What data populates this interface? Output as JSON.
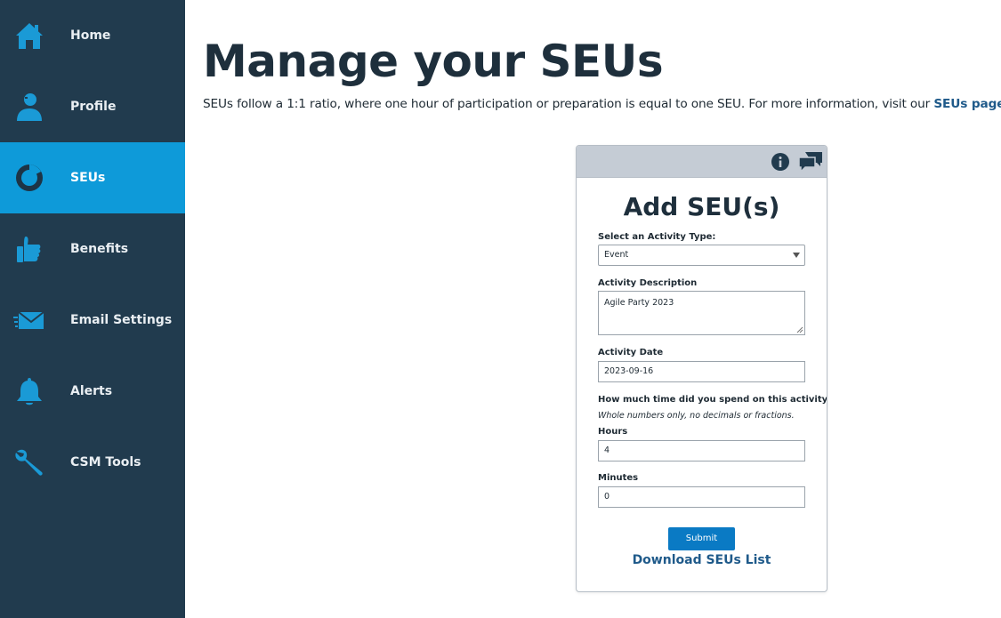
{
  "sidebar": {
    "items": [
      {
        "label": "Home",
        "icon": "home-icon"
      },
      {
        "label": "Profile",
        "icon": "profile-icon"
      },
      {
        "label": "SEUs",
        "icon": "seus-icon",
        "active": true
      },
      {
        "label": "Benefits",
        "icon": "thumbs-up-icon"
      },
      {
        "label": "Email Settings",
        "icon": "envelope-icon"
      },
      {
        "label": "Alerts",
        "icon": "bell-icon"
      },
      {
        "label": "CSM Tools",
        "icon": "wrench-icon"
      }
    ],
    "colors": {
      "background": "#213b4e",
      "active": "#0e9ad9",
      "icon": "#1a9ad6"
    }
  },
  "main": {
    "title": "Manage your SEUs",
    "intro_text": "SEUs follow a 1:1 ratio, where one hour of participation or preparation is equal to one SEU. For more information, visit our ",
    "intro_link": "SEUs page",
    "intro_end": "."
  },
  "form": {
    "title": "Add SEU(s)",
    "activity_type_label": "Select an Activity Type:",
    "activity_type_value": "Event",
    "description_label": "Activity Description",
    "description_value": "Agile Party 2023",
    "date_label": "Activity Date",
    "date_value": "2023-09-16",
    "time_question": "How much time did you spend on this activity?",
    "time_hint": "Whole numbers only, no decimals or fractions.",
    "hours_label": "Hours",
    "hours_value": "4",
    "minutes_label": "Minutes",
    "minutes_value": "0",
    "submit_label": "Submit",
    "download_label": "Download SEUs List",
    "header_icons": [
      "info-icon",
      "chat-icon"
    ]
  }
}
